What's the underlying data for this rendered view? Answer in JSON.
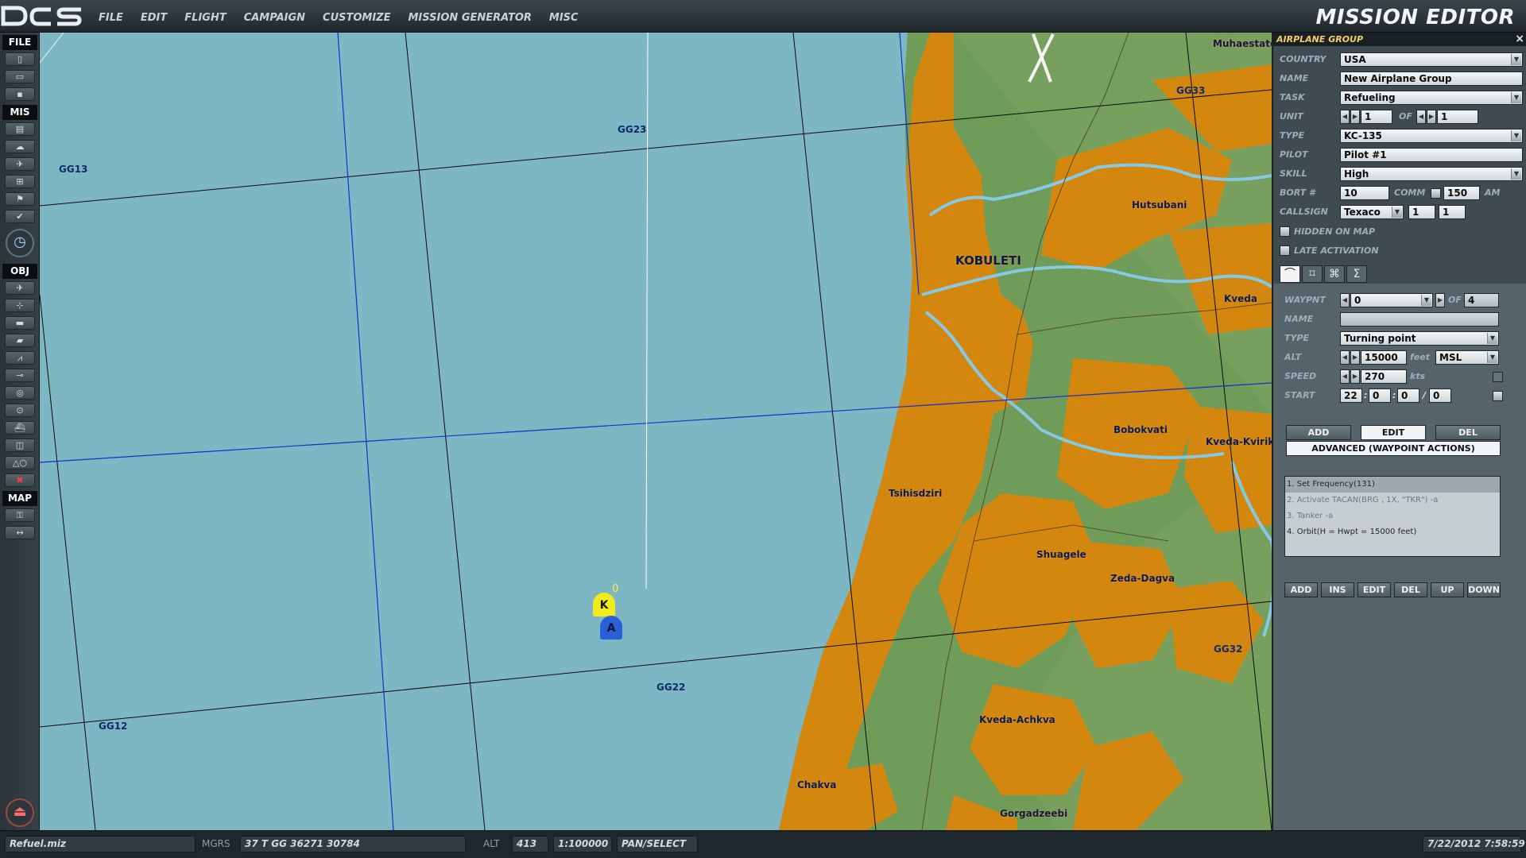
{
  "app": {
    "title": "MISSION EDITOR",
    "logo_text": "DCS"
  },
  "menu": [
    "FILE",
    "EDIT",
    "FLIGHT",
    "CAMPAIGN",
    "CUSTOMIZE",
    "MISSION GENERATOR",
    "MISC"
  ],
  "left_toolbar": {
    "sections": {
      "file": "FILE",
      "mis": "MIS",
      "obj": "OBJ",
      "map": "MAP"
    }
  },
  "map": {
    "grid_labels": {
      "gg13": "GG13",
      "gg23": "GG23",
      "gg33": "GG33",
      "gg12": "GG12",
      "gg22": "GG22",
      "gg32": "GG32"
    },
    "towns": {
      "muhaestate": "Muhaestate",
      "hutsubani": "Hutsubani",
      "kobuleti": "KOBULETI",
      "kveda": "Kveda",
      "bobokvati": "Bobokvati",
      "kveda_kvirike": "Kveda-Kvirike",
      "tsihisdziri": "Tsihisdziri",
      "shuagele": "Shuagele",
      "zeda_dagva": "Zeda-Dagva",
      "kveda_achkva": "Kveda-Achkva",
      "chakva": "Chakva",
      "gorgadzeebi": "Gorgadzeebi"
    },
    "units": {
      "tanker_letter": "K",
      "awacs_letter": "A",
      "waypoint_index": "0"
    },
    "colors": {
      "sea": "#7db7c3",
      "land": "#6f9c58",
      "urban": "#d4870f",
      "river": "#86c9e4"
    }
  },
  "panel": {
    "header": "AIRPLANE GROUP",
    "close": "×",
    "labels": {
      "country": "COUNTRY",
      "name": "NAME",
      "task": "TASK",
      "unit": "UNIT",
      "of": "OF",
      "type": "TYPE",
      "pilot": "PILOT",
      "skill": "SKILL",
      "bort": "BORT #",
      "comm": "COMM",
      "am": "AM",
      "callsign": "CALLSIGN",
      "hidden": "HIDDEN ON MAP",
      "late": "LATE ACTIVATION"
    },
    "values": {
      "country": "USA",
      "name": "New Airplane Group",
      "task": "Refueling",
      "unit": "1",
      "unit_of": "1",
      "type": "KC-135",
      "pilot": "Pilot #1",
      "skill": "High",
      "bort": "10",
      "comm": "150",
      "callsign": "Texaco",
      "callsign_n1": "1",
      "callsign_n2": "1"
    },
    "tab_icons": [
      "route-icon",
      "target-icon",
      "payload-icon",
      "sum-icon"
    ],
    "tab_glyphs": [
      "⌒",
      "⌑",
      "⌘",
      "Σ"
    ],
    "waypoint": {
      "labels": {
        "waypnt": "WAYPNT",
        "of": "OF",
        "name": "NAME",
        "type": "TYPE",
        "alt": "ALT",
        "feet": "feet",
        "speed": "SPEED",
        "kts": "kts",
        "start": "START"
      },
      "values": {
        "waypnt": "0",
        "of": "4",
        "name": "",
        "type": "Turning point",
        "alt": "15000",
        "alt_ref": "MSL",
        "speed": "270",
        "start_h": "22",
        "start_m": "0",
        "start_s": "0",
        "start_d": "0"
      },
      "buttons": {
        "add": "ADD",
        "edit": "EDIT",
        "del": "DEL",
        "advanced": "ADVANCED (WAYPOINT ACTIONS)"
      }
    },
    "actions": [
      "1. Set Frequency(131)",
      "2. Activate TACAN(BRG , 1X, \"TKR\")   -a",
      "3. Tanker -a",
      "4. Orbit(H = Hwpt = 15000 feet)"
    ],
    "action_buttons": {
      "add": "ADD",
      "ins": "INS",
      "edit": "EDIT",
      "del": "DEL",
      "up": "UP",
      "down": "DOWN"
    }
  },
  "status": {
    "file": "Refuel.miz",
    "mgrs_label": "MGRS",
    "mgrs": "37 T GG 36271 30784",
    "alt_label": "ALT",
    "alt": "413",
    "scale": "1:100000",
    "mode": "PAN/SELECT",
    "datetime": "7/22/2012 7:58:59"
  }
}
